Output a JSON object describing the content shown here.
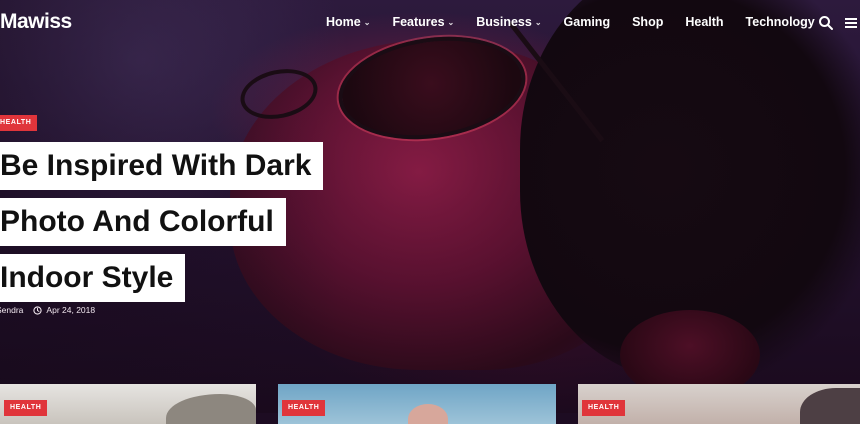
{
  "site": {
    "logo": "Mawiss"
  },
  "nav": {
    "items": [
      {
        "label": "Home",
        "has_dropdown": true
      },
      {
        "label": "Features",
        "has_dropdown": true
      },
      {
        "label": "Business",
        "has_dropdown": true
      },
      {
        "label": "Gaming",
        "has_dropdown": false
      },
      {
        "label": "Shop",
        "has_dropdown": false
      },
      {
        "label": "Health",
        "has_dropdown": false
      },
      {
        "label": "Technology",
        "has_dropdown": false
      }
    ],
    "chevron": "⌄"
  },
  "hero": {
    "category": "HEALTH",
    "title_lines": [
      "Be Inspired With Dark",
      "Photo And Colorful",
      "Indoor Style"
    ],
    "author": "Sendra",
    "date": "Apr 24, 2018"
  },
  "cards": [
    {
      "category": "HEALTH"
    },
    {
      "category": "HEALTH"
    },
    {
      "category": "HEALTH"
    }
  ],
  "colors": {
    "accent": "#e0353b",
    "text_on_dark": "#ffffff",
    "title_bg": "#ffffff",
    "title_text": "#111111"
  },
  "icons": [
    "search-icon",
    "menu-icon",
    "clock-icon",
    "chevron-down-icon"
  ]
}
